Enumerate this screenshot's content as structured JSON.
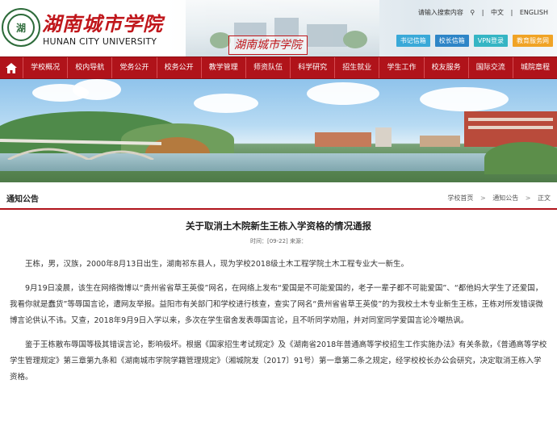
{
  "header": {
    "school_name_cn": "湖南城市学院",
    "school_name_en": "HUNAN CITY UNIVERSITY",
    "logo_text": "湖",
    "campus_stamp": "湖南城市学院",
    "search_placeholder": "请输入搜索内容",
    "lang_cn": "中文",
    "lang_en": "ENGLISH",
    "quick_buttons": [
      {
        "label": "书记信箱",
        "color": "#3aa9d8"
      },
      {
        "label": "校长信箱",
        "color": "#2e85c7"
      },
      {
        "label": "VPN登录",
        "color": "#35b5c4"
      },
      {
        "label": "教育服务网",
        "color": "#f0a325"
      }
    ]
  },
  "nav": {
    "home_icon": "home-icon",
    "items": [
      "学校概况",
      "校内导航",
      "党务公开",
      "校务公开",
      "教学管理",
      "师资队伍",
      "科学研究",
      "招生就业",
      "学生工作",
      "校友服务",
      "国际交流",
      "城院章程"
    ]
  },
  "section": {
    "title": "通知公告",
    "breadcrumb": [
      "学校首页",
      "通知公告",
      "正文"
    ]
  },
  "article": {
    "title": "关于取消土木院新生王栋入学资格的情况通报",
    "meta": "时间：[09-22]  来源：",
    "paragraphs": [
      "王栋，男，汉族，2000年8月13日出生，湖南祁东县人，现为学校2018级土木工程学院土木工程专业大一新生。",
      "9月19日凌晨，该生在网络微博以“贵州省省草王英俊”网名，在网络上发布“爱国是不可能爱国的，老子一辈子都不可能爱国”、“都他妈大学生了还爱国，我看你就是蠢货”等辱国言论，遭网友举报。益阳市有关部门和学校进行核查，查实了网名“贵州省省草王英俊”的为我校土木专业新生王栋，王栋对所发错误微博言论供认不讳。又查，2018年9月9日入学以来，多次在学生宿舍发表辱国言论，且不听同学劝阻，并对同室同学爱国言论冷嘲热讽。",
      "鉴于王栋散布辱国等极其错误言论，影响极坏。根据《国家招生考试规定》及《湖南省2018年普通高等学校招生工作实施办法》有关条款，《普通高等学校学生管理规定》第三章第九条和《湖南城市学院学籍管理规定》（湘城院发〔2017〕91号）第一章第二条之规定，经学校校长办公会研究，决定取消王栋入学资格。"
    ]
  }
}
